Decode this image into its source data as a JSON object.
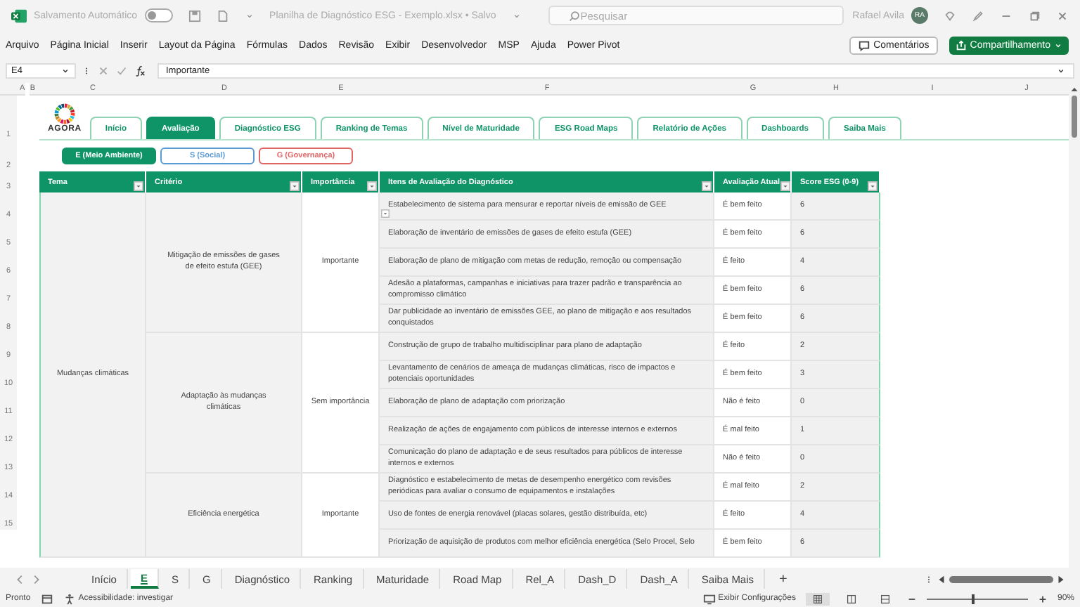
{
  "title_bar": {
    "autosave_label": "Salvamento Automático",
    "autosave_on": false,
    "file_title": "Planilha de Diagnóstico ESG - Exemplo.xlsx • Salvo",
    "search_placeholder": "Pesquisar",
    "user_name": "Rafael Avila",
    "user_initials": "RA"
  },
  "menu": [
    "Arquivo",
    "Página Inicial",
    "Inserir",
    "Layout da Página",
    "Fórmulas",
    "Dados",
    "Revisão",
    "Exibir",
    "Desenvolvedor",
    "MSP",
    "Ajuda",
    "Power Pivot"
  ],
  "comments_button": "Comentários",
  "share_button": "Compartilhamento",
  "formula_bar": {
    "cell": "E4",
    "value": "Importante"
  },
  "column_headers": [
    "A",
    "B",
    "C",
    "D",
    "E",
    "F",
    "G",
    "H",
    "I",
    "J"
  ],
  "row_numbers": [
    "1",
    "2",
    "3",
    "4",
    "5",
    "6",
    "7",
    "8",
    "9",
    "10",
    "11",
    "12",
    "13",
    "14",
    "15"
  ],
  "logo": {
    "text": "AGORA"
  },
  "nav_tabs": [
    {
      "label": "Início",
      "selected": false
    },
    {
      "label": "Avaliação",
      "selected": true
    },
    {
      "label": "Diagnóstico ESG",
      "selected": false
    },
    {
      "label": "Ranking de Temas",
      "selected": false
    },
    {
      "label": "Nível de Maturidade",
      "selected": false
    },
    {
      "label": "ESG Road Maps",
      "selected": false
    },
    {
      "label": "Relatório de Ações",
      "selected": false
    },
    {
      "label": "Dashboards",
      "selected": false
    },
    {
      "label": "Saiba Mais",
      "selected": false
    }
  ],
  "pillars": [
    {
      "label": "E (Meio Ambiente)",
      "selected": true,
      "color": "#0e9467"
    },
    {
      "label": "S (Social)",
      "selected": false,
      "color": "#5b9bd5"
    },
    {
      "label": "G (Governança)",
      "selected": false,
      "color": "#e06666"
    }
  ],
  "table": {
    "columns": [
      "Tema",
      "Critério",
      "Importância",
      "Itens de Avaliação do Diagnóstico",
      "Avaliação Atual",
      "Score ESG (0-9)"
    ],
    "themes": [
      {
        "name": "Mudanças climáticas",
        "criteria": [
          {
            "name": "Mitigação de emissões de gases de efeito estufa (GEE)",
            "importance": "Importante",
            "items": [
              {
                "text": "Estabelecimento de sistema para mensurar e reportar níveis de emissão de GEE",
                "evaluation": "É bem feito",
                "score": "6"
              },
              {
                "text": "Elaboração de inventário de emissões de gases de efeito estufa (GEE)",
                "evaluation": "É bem feito",
                "score": "6"
              },
              {
                "text": "Elaboração de plano de mitigação com metas de redução, remoção ou compensação",
                "evaluation": "É feito",
                "score": "4"
              },
              {
                "text": "Adesão a plataformas, campanhas e iniciativas para trazer padrão e transparência ao compromisso climático",
                "evaluation": "É bem feito",
                "score": "6"
              },
              {
                "text": "Dar publicidade ao inventário de emissões GEE, ao plano de mitigação e aos resultados conquistados",
                "evaluation": "É bem feito",
                "score": "6"
              }
            ]
          },
          {
            "name": "Adaptação às mudanças climáticas",
            "importance": "Sem importância",
            "items": [
              {
                "text": "Construção de grupo de trabalho multidisciplinar para plano de adaptação",
                "evaluation": "É feito",
                "score": "2"
              },
              {
                "text": "Levantamento de cenários de ameaça de mudanças climáticas, risco de impactos e potenciais oportunidades",
                "evaluation": "É bem feito",
                "score": "3"
              },
              {
                "text": "Elaboração de plano de adaptação com priorização",
                "evaluation": "Não é feito",
                "score": "0"
              },
              {
                "text": "Realização de ações de engajamento com públicos de interesse internos e externos",
                "evaluation": "É mal feito",
                "score": "1"
              },
              {
                "text": "Comunicação do plano de adaptação e de seus resultados para públicos de interesse internos e externos",
                "evaluation": "Não é feito",
                "score": "0"
              }
            ]
          },
          {
            "name": "Eficiência energética",
            "importance": "Importante",
            "items": [
              {
                "text": "Diagnóstico e estabelecimento de metas de desempenho energético com revisões periódicas para avaliar o consumo de equipamentos e instalações",
                "evaluation": "É mal feito",
                "score": "2"
              },
              {
                "text": "Uso de fontes de energia renovável (placas solares, gestão distribuída, etc)",
                "evaluation": "É feito",
                "score": "4"
              },
              {
                "text": "Priorização de aquisição de produtos com melhor eficiência energética (Selo Procel, Selo",
                "evaluation": "É bem feito",
                "score": "6"
              }
            ]
          }
        ]
      }
    ]
  },
  "sheet_tabs": [
    {
      "label": "Início",
      "selected": false
    },
    {
      "label": "E",
      "selected": true
    },
    {
      "label": "S",
      "selected": false
    },
    {
      "label": "G",
      "selected": false
    },
    {
      "label": "Diagnóstico",
      "selected": false
    },
    {
      "label": "Ranking",
      "selected": false
    },
    {
      "label": "Maturidade",
      "selected": false
    },
    {
      "label": "Road Map",
      "selected": false
    },
    {
      "label": "Rel_A",
      "selected": false
    },
    {
      "label": "Dash_D",
      "selected": false
    },
    {
      "label": "Dash_A",
      "selected": false
    },
    {
      "label": "Saiba Mais",
      "selected": false
    }
  ],
  "add_sheet": "+",
  "status_bar": {
    "state": "Pronto",
    "accessibility": "Acessibilidade: investigar",
    "display_settings": "Exibir Configurações",
    "zoom": "90%",
    "zoom_slider": {
      "level": 0.45
    }
  }
}
